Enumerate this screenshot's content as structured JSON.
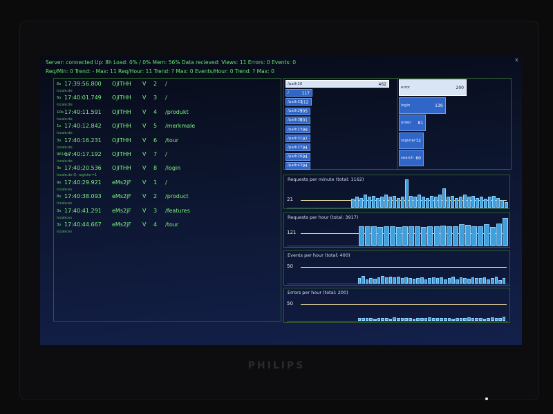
{
  "monitor": {
    "brand": "PHILIPS"
  },
  "status": {
    "line1": "Server: connected Up: 8h Load: 0% / 0% Mem: 56%  Data recieved:  Views: 11 Errors: 0 Events: 0",
    "line2": "Req/Min: 0 Trend: - Max: 11  Req/Hour: 11 Trend: ? Max: 0   Events/Hour: 0 Trend: ? Max: 0",
    "close_glyph": "x"
  },
  "log": [
    {
      "duration": "6s",
      "time": "17:39:56.800",
      "session": "OjITHH",
      "type": "V",
      "seq": "2",
      "path": "/",
      "meta": "locale:de"
    },
    {
      "duration": "5s",
      "time": "17:40:01.749",
      "session": "OjITHH",
      "type": "V",
      "seq": "3",
      "path": "/",
      "meta": "locale:de"
    },
    {
      "duration": "10s",
      "time": "17:40:11.591",
      "session": "OjITHH",
      "type": "V",
      "seq": "4",
      "path": "/produkt",
      "meta": "locale:de"
    },
    {
      "duration": "1s",
      "time": "17:40:12.842",
      "session": "OjITHH",
      "type": "V",
      "seq": "5",
      "path": "/merkmale",
      "meta": "locale:de"
    },
    {
      "duration": "3s",
      "time": "17:40:16.231",
      "session": "OjITHH",
      "type": "V",
      "seq": "6",
      "path": "/tour",
      "meta": "locale:de"
    },
    {
      "duration": "961ms",
      "time": "17:40:17.192",
      "session": "OjITHH",
      "type": "V",
      "seq": "7",
      "path": "/",
      "meta": "locale:de"
    },
    {
      "duration": "3s",
      "time": "17:40:20.536",
      "session": "OjITHH",
      "type": "V",
      "seq": "8",
      "path": "/login",
      "meta": "locale:de  Q: register=1"
    },
    {
      "duration": "9s",
      "time": "17:40:29.921",
      "session": "eMs2jF",
      "type": "V",
      "seq": "1",
      "path": "/",
      "meta": "locale:es"
    },
    {
      "duration": "8s",
      "time": "17:40:38.093",
      "session": "eMs2jF",
      "type": "V",
      "seq": "2",
      "path": "/product",
      "meta": "locale:es"
    },
    {
      "duration": "3s",
      "time": "17:40:41.291",
      "session": "eMs2jF",
      "type": "V",
      "seq": "3",
      "path": "/features",
      "meta": "locale:es"
    },
    {
      "duration": "3s",
      "time": "17:40:44.667",
      "session": "eMs2jF",
      "type": "V",
      "seq": "4",
      "path": "/tour",
      "meta": "locale:es"
    }
  ],
  "paths": [
    {
      "label": "/path10",
      "value": "462",
      "fraction": 1.0
    },
    {
      "label": "/",
      "value": "117",
      "fraction": 0.26
    },
    {
      "label": "/path33",
      "value": "112",
      "fraction": 0.25
    },
    {
      "label": "/path24",
      "value": "105",
      "fraction": 0.23
    },
    {
      "label": "/path30",
      "value": "101",
      "fraction": 0.22
    },
    {
      "label": "/path23",
      "value": "99",
      "fraction": 0.22
    },
    {
      "label": "/path31",
      "value": "97",
      "fraction": 0.21
    },
    {
      "label": "/path27",
      "value": "94",
      "fraction": 0.21
    },
    {
      "label": "/path26",
      "value": "94",
      "fraction": 0.21
    },
    {
      "label": "/path43",
      "value": "94",
      "fraction": 0.21
    }
  ],
  "errors": [
    {
      "label": "error",
      "value": "200",
      "fraction": 1.0
    },
    {
      "label": "login",
      "value": "139",
      "fraction": 0.69
    },
    {
      "label": "order",
      "value": "81",
      "fraction": 0.4
    },
    {
      "label": "register",
      "value": "72",
      "fraction": 0.36
    },
    {
      "label": "search",
      "value": "60",
      "fraction": 0.3
    }
  ],
  "charts": [
    {
      "title": "Requests per minute (total: 1162)",
      "ref_value": "21",
      "values": [
        8,
        10,
        9,
        12,
        10,
        11,
        9,
        10,
        12,
        10,
        11,
        9,
        10,
        26,
        11,
        10,
        12,
        10,
        9,
        11,
        10,
        12,
        18,
        10,
        11,
        9,
        10,
        12,
        10,
        11,
        9,
        10,
        8,
        10,
        11,
        9,
        7,
        5
      ],
      "ymax": 26
    },
    {
      "title": "Requests per hour (total: 3917)",
      "ref_value": "121",
      "values": [
        102,
        104,
        102,
        100,
        104,
        102,
        100,
        102,
        104,
        102,
        100,
        104,
        102,
        106,
        104,
        102,
        112,
        108,
        102,
        104,
        112,
        100,
        118,
        145
      ],
      "ymax": 150
    },
    {
      "title": "Events per hour (total: 400)",
      "ref_value": "50",
      "values": [
        12,
        18,
        10,
        12,
        11,
        14,
        18,
        14,
        16,
        14,
        16,
        12,
        15,
        12,
        11,
        12,
        14,
        10,
        12,
        14,
        12,
        14,
        10,
        12,
        16,
        10,
        15,
        12,
        11,
        14,
        12,
        13,
        14,
        10,
        12,
        16,
        8,
        13
      ],
      "ymax": 65
    },
    {
      "title": "Errors per hour (total: 200)",
      "ref_value": "50",
      "values": [
        6,
        6,
        6,
        7,
        5,
        6,
        7,
        6,
        5,
        8,
        6,
        7,
        6,
        7,
        5,
        6,
        6,
        7,
        8,
        6,
        7,
        6,
        7,
        7,
        5,
        6,
        6,
        7,
        8,
        6,
        7,
        6,
        5,
        7,
        8,
        6,
        7,
        10
      ],
      "ymax": 65
    }
  ]
}
